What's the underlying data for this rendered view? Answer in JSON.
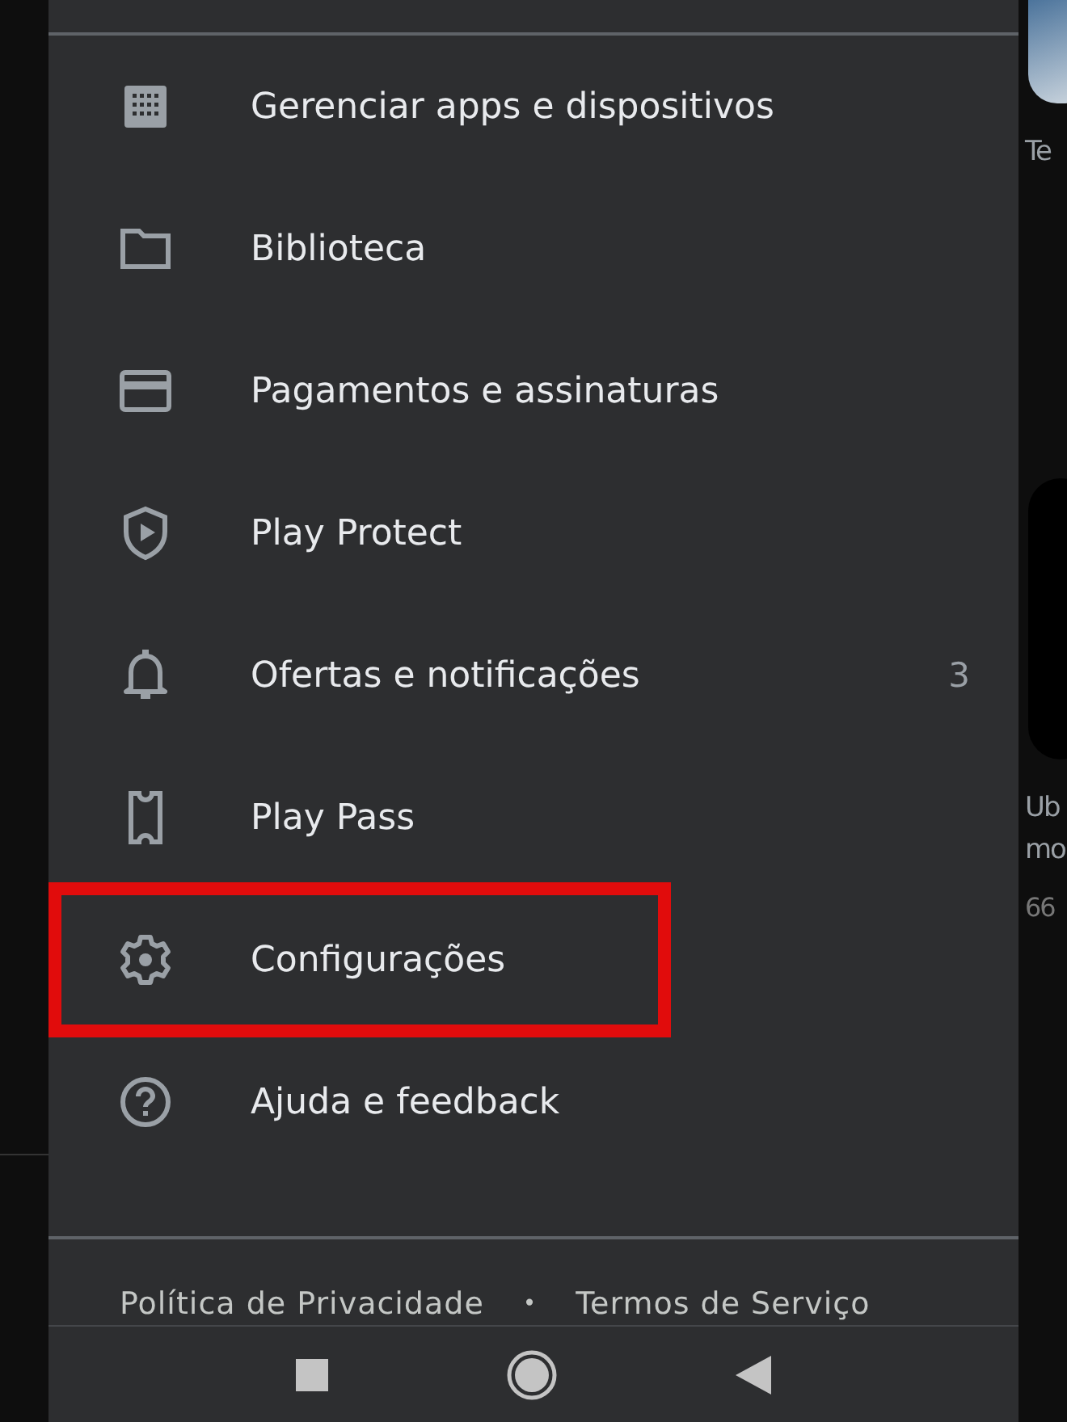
{
  "drawer": {
    "items": [
      {
        "label": "Gerenciar apps e dispositivos",
        "highlighted": false
      },
      {
        "label": "Biblioteca",
        "highlighted": false
      },
      {
        "label": "Pagamentos e assinaturas",
        "highlighted": false
      },
      {
        "label": "Play Protect",
        "highlighted": false
      },
      {
        "label": "Ofertas e notificações",
        "badge": "3",
        "highlighted": false
      },
      {
        "label": "Play Pass",
        "highlighted": false
      },
      {
        "label": "Configurações",
        "highlighted": true
      },
      {
        "label": "Ajuda e feedback",
        "highlighted": false
      }
    ],
    "footer": {
      "links": [
        "Política de Privacidade",
        "Termos de Serviço"
      ],
      "separator": "•"
    }
  },
  "background": {
    "texts": [
      "Te",
      "Ub",
      "mo",
      "66"
    ]
  }
}
